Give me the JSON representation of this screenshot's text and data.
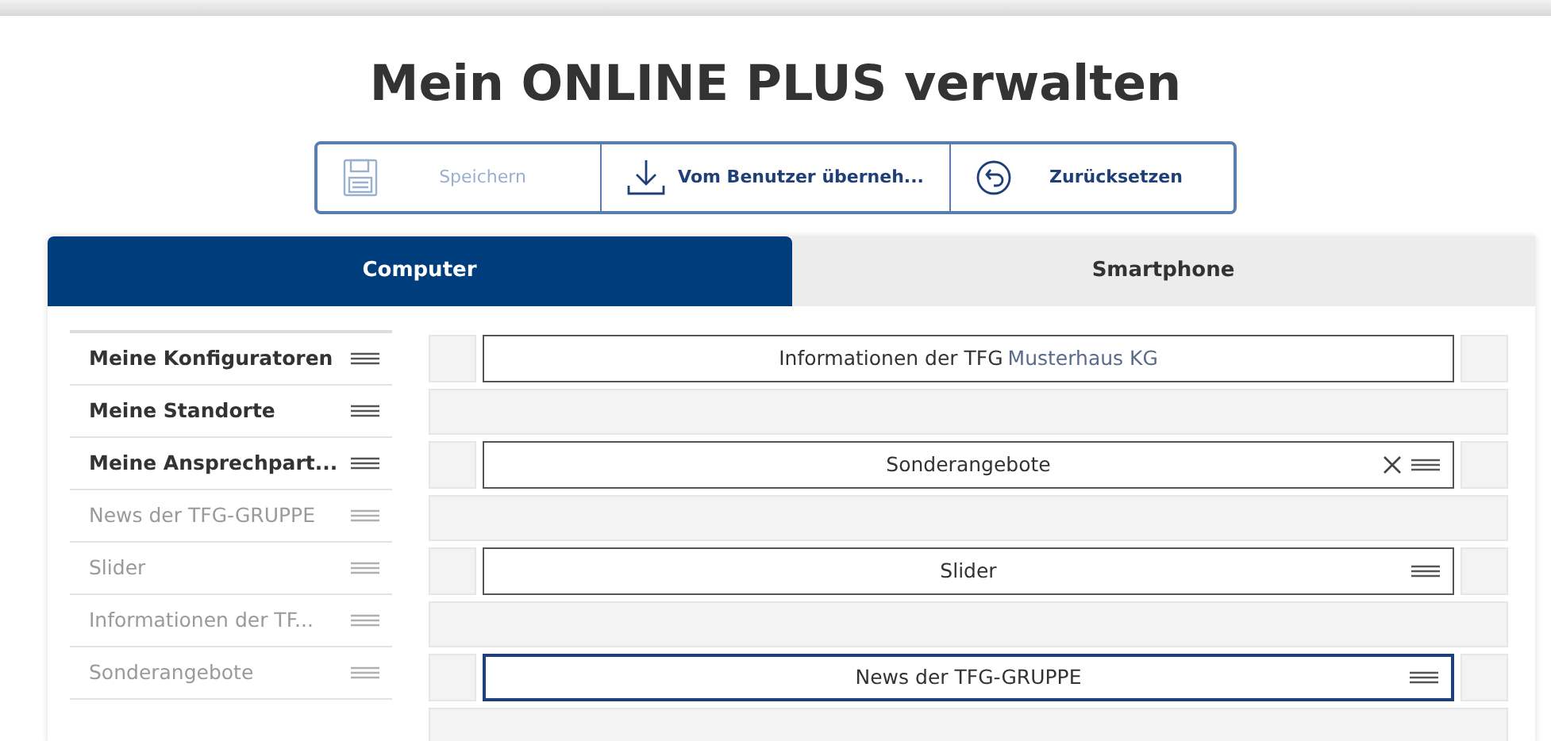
{
  "title": "Mein ONLINE PLUS verwalten",
  "toolbar": [
    {
      "kind": "save",
      "label": "Speichern",
      "disabled": true
    },
    {
      "kind": "download",
      "label": "Vom Benutzer überneh...",
      "disabled": false
    },
    {
      "kind": "reset",
      "label": "Zurücksetzen",
      "disabled": false
    }
  ],
  "tabs": [
    {
      "label": "Computer",
      "selected": true
    },
    {
      "label": "Smartphone",
      "selected": false
    }
  ],
  "sidebar": {
    "items": [
      {
        "label": "Meine Konfiguratoren",
        "active": true
      },
      {
        "label": "Meine Standorte",
        "active": true
      },
      {
        "label": "Meine Ansprechpart...",
        "active": true
      },
      {
        "label": "News der TFG-GRUPPE",
        "active": false
      },
      {
        "label": "Slider",
        "active": false
      },
      {
        "label": "Informationen der TF...",
        "active": false
      },
      {
        "label": "Sonderangebote",
        "active": false
      }
    ]
  },
  "canvas": {
    "rows": [
      {
        "kind": "slot",
        "label": "Informationen der TFG",
        "label_overlay": "Musterhaus KG",
        "removable": false,
        "draggable": false,
        "selected": false
      },
      {
        "kind": "gap"
      },
      {
        "kind": "slot",
        "label": "Sonderangebote",
        "removable": true,
        "draggable": true,
        "selected": false
      },
      {
        "kind": "gap"
      },
      {
        "kind": "slot",
        "label": "Slider",
        "removable": false,
        "draggable": true,
        "selected": false
      },
      {
        "kind": "gap"
      },
      {
        "kind": "slot",
        "label": "News der TFG-GRUPPE",
        "removable": false,
        "draggable": true,
        "selected": true
      },
      {
        "kind": "gap"
      }
    ]
  }
}
